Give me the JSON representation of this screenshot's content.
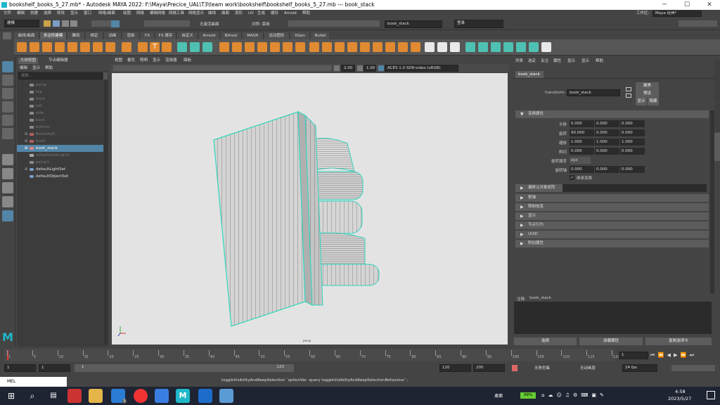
{
  "window": {
    "title": "bookshelf_books_5_27.mb* - Autodesk MAYA 2022: F:\\Maya\\Precice_UAL\\T3\\team work\\bookshelf\\bookshelf_books_5_27.mb  ---  book_stack",
    "minimize": "─",
    "maximize": "☐",
    "close": "✕"
  },
  "menubar": {
    "items": [
      "文件",
      "编辑",
      "创建",
      "选择",
      "修改",
      "显示",
      "窗口",
      "网格/曲面",
      "绘图",
      "网格",
      "编辑网格",
      "网格工具",
      "网格显示",
      "曲线",
      "曲面",
      "变形",
      "UV",
      "生成",
      "缓存",
      "Arnold",
      "帮助"
    ],
    "workspace_label": "工作区:",
    "workspace_value": "Maya 经典*"
  },
  "statusline": {
    "mode": "建模",
    "live_surface": "无激活曲面",
    "symmetry": "对称: 禁用",
    "search_value": "book_stack",
    "login": "登录"
  },
  "shelf": {
    "tabs": [
      "曲线/曲面",
      "多边形建模",
      "雕刻",
      "绑定",
      "动画",
      "渲染",
      "FX",
      "FX 缓存",
      "自定义",
      "Arnold",
      "Bifrost",
      "MASH",
      "运动图形",
      "XGen",
      "Bullet"
    ],
    "active_tab": "多边形建模"
  },
  "outliner": {
    "tabs": [
      "大纲视图",
      "节点编辑器"
    ],
    "menu": [
      "编辑",
      "显示",
      "帮助"
    ],
    "search_placeholder": "搜索...",
    "items": [
      {
        "label": "persp",
        "state": "dim"
      },
      {
        "label": "top",
        "state": "dim"
      },
      {
        "label": "front",
        "state": "dim"
      },
      {
        "label": "left",
        "state": "dim"
      },
      {
        "label": "side",
        "state": "dim"
      },
      {
        "label": "back",
        "state": "dim"
      },
      {
        "label": "bottom",
        "state": "dim"
      },
      {
        "label": "Bookshelf",
        "state": "dim"
      },
      {
        "label": "book",
        "state": "dim"
      },
      {
        "label": "book_stack",
        "state": "selected"
      },
      {
        "label": "aiSkyDomeLight1",
        "state": "dim"
      },
      {
        "label": "persp1",
        "state": "dim"
      },
      {
        "label": "defaultLightSet",
        "state": "normal"
      },
      {
        "label": "defaultObjectSet",
        "state": "normal"
      }
    ]
  },
  "viewport": {
    "menu": [
      "视图",
      "着色",
      "照明",
      "显示",
      "渲染器",
      "面板"
    ],
    "gamma": "2.00",
    "exposure": "1.00",
    "colorspace": "ACES 1.0 SDR-video (sRGB)",
    "camera_label": "persp"
  },
  "attribute_editor": {
    "menu": [
      "列表",
      "选定",
      "关注",
      "属性",
      "显示",
      "显示",
      "帮助"
    ],
    "node_tab": "book_stack",
    "transform_label": "transform:",
    "transform_value": "book_stack",
    "focus_button": "聚焦",
    "preset_button": "预设",
    "show_button": "显示",
    "hide_button": "隐藏",
    "section_transform": "变换属性",
    "translate": {
      "label": "平移",
      "values": [
        "0.000",
        "0.000",
        "0.000"
      ]
    },
    "rotate": {
      "label": "旋转",
      "values": [
        "90.000",
        "0.000",
        "0.000"
      ]
    },
    "scale": {
      "label": "缩放",
      "values": [
        "1.000",
        "1.000",
        "1.000"
      ]
    },
    "shear": {
      "label": "斜切",
      "values": [
        "0.000",
        "0.000",
        "0.000"
      ]
    },
    "rotate_order": {
      "label": "旋转顺序",
      "value": "xyz"
    },
    "rotate_axis": {
      "label": "旋转轴",
      "values": [
        "0.000",
        "0.000",
        "0.000"
      ]
    },
    "inherit_transform": "继承变换",
    "sections": [
      "偏移父对象矩阵",
      "枢轴",
      "限制信息",
      "显示",
      "节点行为",
      "UUID",
      "附加属性"
    ],
    "notes_label": "注释:",
    "notes_node": "book_stack",
    "bottom_buttons": [
      "选择",
      "加载属性",
      "复制选项卡"
    ]
  },
  "timeslider": {
    "ticks": [
      "1",
      "5",
      "10",
      "15",
      "20",
      "25",
      "30",
      "35",
      "40",
      "45",
      "50",
      "55",
      "60",
      "65",
      "70",
      "75",
      "80",
      "85",
      "90",
      "95",
      "100",
      "105",
      "110",
      "115",
      "120"
    ],
    "current_frame": "1"
  },
  "rangebar": {
    "start": "1",
    "start_inner": "1",
    "range_start_label": "1",
    "range_end_label": "120",
    "end_inner": "120",
    "end": "200",
    "character_set": "无角色集",
    "anim_layer": "无动画层",
    "fps": "24 fps"
  },
  "commandline": {
    "lang": "MEL",
    "output": "toggleVisibilityAndKeepSelection `optionVar -query toggleVisibilityAndKeepSelectionBehaviour`;"
  },
  "taskbar": {
    "desktop": "桌面",
    "battery": "99%",
    "time": "4:58",
    "date": "2023/5/27",
    "badge": "5"
  }
}
